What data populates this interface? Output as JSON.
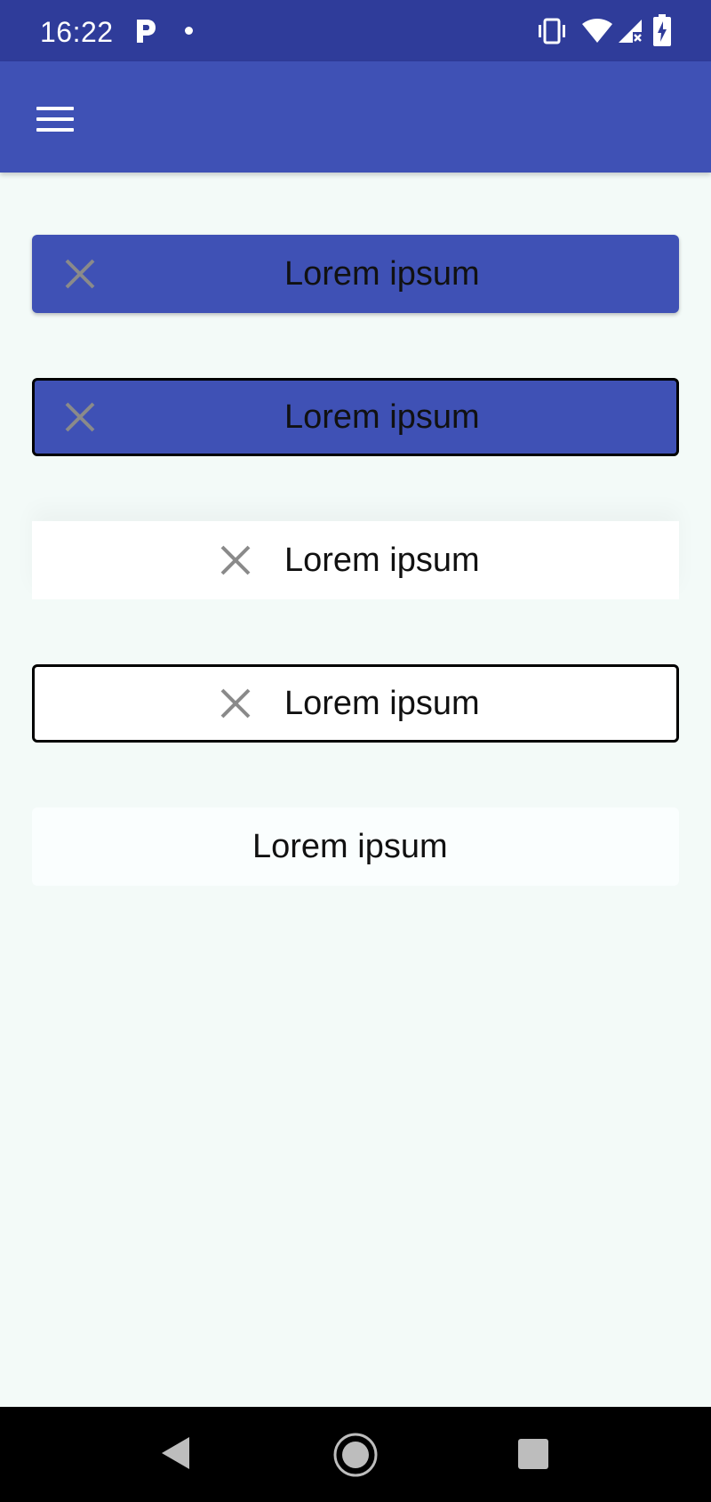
{
  "status_bar": {
    "time": "16:22",
    "icons": [
      "parking-app-icon",
      "notification-dot-icon",
      "vibrate-icon",
      "wifi-icon",
      "cell-signal-no-data-icon",
      "battery-charging-icon"
    ]
  },
  "app_bar": {
    "menu_icon": "hamburger-menu-icon",
    "color": "#3f51b5"
  },
  "chips": [
    {
      "label": "Lorem ipsum",
      "icon": "close-icon",
      "style": "filled-primary"
    },
    {
      "label": "Lorem ipsum",
      "icon": "close-icon",
      "style": "filled-primary-outlined"
    },
    {
      "label": "Lorem ipsum",
      "icon": "close-icon",
      "style": "white"
    },
    {
      "label": "Lorem ipsum",
      "icon": "close-icon",
      "style": "white-outlined"
    },
    {
      "label": "Lorem ipsum",
      "style": "plain"
    }
  ],
  "nav_bar": {
    "icons": [
      "back-icon",
      "home-icon",
      "recents-icon"
    ]
  },
  "colors": {
    "status_bar": "#2f3c9a",
    "primary": "#3f51b5",
    "background": "#f3faf8",
    "close_icon": "#8a8a8a",
    "text": "#111111"
  }
}
